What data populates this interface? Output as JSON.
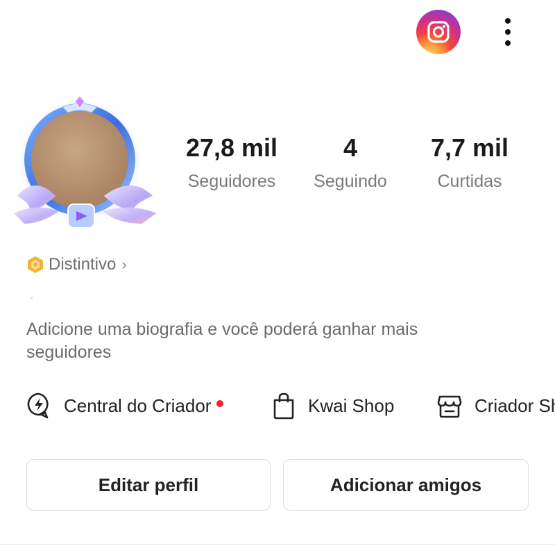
{
  "topbar": {
    "instagram_icon": "instagram-icon",
    "more_icon": "vertical-ellipsis-icon"
  },
  "profile": {
    "avatar_icon": "avatar-with-winged-frame"
  },
  "stats": [
    {
      "value": "27,8 mil",
      "label": "Seguidores"
    },
    {
      "value": "4",
      "label": "Seguindo"
    },
    {
      "value": "7,7 mil",
      "label": "Curtidas"
    }
  ],
  "badge": {
    "icon": "hexagon-badge-icon",
    "label": "Distintivo",
    "chevron": "›"
  },
  "bio": {
    "text": "Adicione uma biografia e você poderá ganhar mais seguidores"
  },
  "shortcuts": [
    {
      "icon": "lightning-circle-icon",
      "label": "Central do Criador",
      "has_notification": true
    },
    {
      "icon": "shopping-bag-icon",
      "label": "Kwai Shop"
    },
    {
      "icon": "storefront-icon",
      "label": "Criador Sh"
    }
  ],
  "buttons": {
    "edit_profile": "Editar perfil",
    "add_friends": "Adicionar amigos"
  },
  "colors": {
    "notification_dot": "#f5222d",
    "badge_gold": "#f0b23a",
    "text_primary": "#222222",
    "text_secondary": "#7a7a7a"
  }
}
